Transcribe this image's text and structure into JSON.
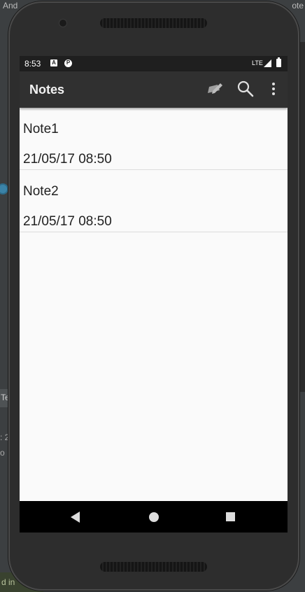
{
  "ide": {
    "top_left": "And",
    "top_right": "ote",
    "left_tab": "Te",
    "left_line1": ": 2",
    "left_line2": "o",
    "bottom_status": "d in"
  },
  "status_bar": {
    "time": "8:53",
    "icon_a": "A",
    "icon_p": "P",
    "network": "LTE"
  },
  "app_bar": {
    "title": "Notes",
    "actions": [
      "edit-note-icon",
      "search-icon",
      "overflow-menu-icon"
    ]
  },
  "notes": [
    {
      "title": "Note1",
      "date": "21/05/17 08:50"
    },
    {
      "title": "Note2",
      "date": "21/05/17 08:50"
    }
  ],
  "nav_bar": {
    "buttons": [
      "back-icon",
      "home-icon",
      "recents-icon"
    ]
  },
  "colors": {
    "appbar": "#303030",
    "statusbar": "#1f1f1f",
    "screen_bg": "#fafafa",
    "navbar": "#000000"
  }
}
